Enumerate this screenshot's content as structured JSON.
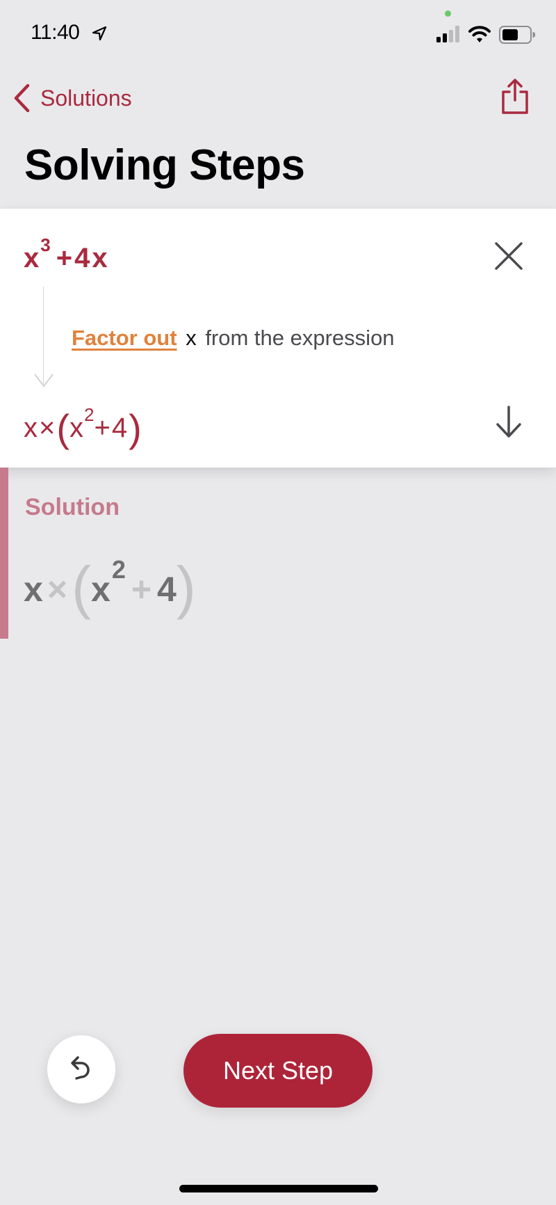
{
  "status_bar": {
    "time": "11:40",
    "icons": [
      "location-arrow-icon",
      "signal-icon",
      "wifi-icon",
      "battery-icon"
    ]
  },
  "nav": {
    "back_label": "Solutions",
    "share_icon": "share-icon",
    "title": "Solving Steps"
  },
  "step": {
    "initial_expression": {
      "base": "x",
      "exponent": "3",
      "rest": "+4x",
      "full": "x^3+4x"
    },
    "explanation": {
      "link_text": "Factor out",
      "variable": "x",
      "rest": "from the expression"
    },
    "result_expression": {
      "prefix": "x×",
      "open_paren": "(",
      "base": "x",
      "exponent": "2",
      "rest": "+4",
      "close_paren": ")",
      "full": "x×(x^2+4)"
    },
    "close_icon": "close-icon",
    "expand_icon": "arrow-down-icon"
  },
  "solution": {
    "label": "Solution",
    "expression": {
      "x1": "x",
      "times": "×",
      "open_paren": "(",
      "x2": "x",
      "exponent": "2",
      "plus": "+",
      "constant": "4",
      "close_paren": ")",
      "full": "x×(x^2+4)"
    }
  },
  "controls": {
    "undo_icon": "undo-icon",
    "next_step_label": "Next Step"
  },
  "colors": {
    "accent": "#ad2439",
    "accent_text": "#a92a3f",
    "link_orange": "#e0823c",
    "solution_pink": "#c67a8b",
    "background": "#e9e9eb"
  }
}
